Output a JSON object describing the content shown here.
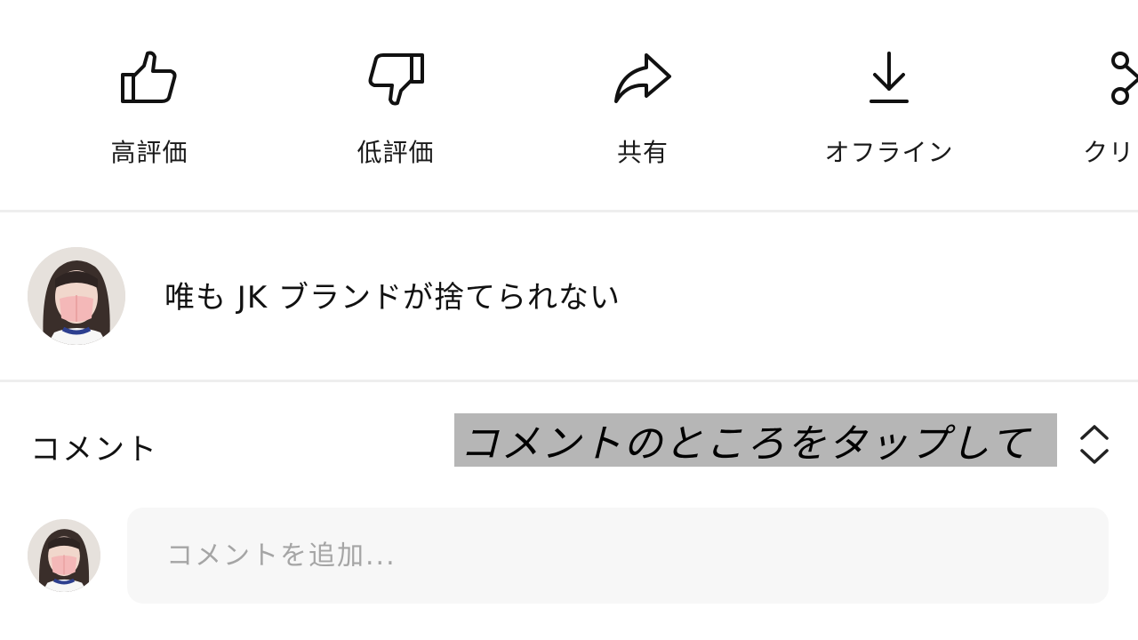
{
  "actions": [
    {
      "id": "like",
      "label": "高評価",
      "icon": "thumbs-up-icon"
    },
    {
      "id": "dislike",
      "label": "低評価",
      "icon": "thumbs-down-icon"
    },
    {
      "id": "share",
      "label": "共有",
      "icon": "share-arrow-icon"
    },
    {
      "id": "download",
      "label": "オフライン",
      "icon": "download-icon"
    },
    {
      "id": "clip",
      "label": "クリ",
      "icon": "scissors-icon"
    }
  ],
  "channel": {
    "title": "唯も JK ブランドが捨てられない",
    "avatar_icon": "channel-avatar"
  },
  "comments": {
    "label": "コメント",
    "overlay_caption": "コメントのところをタップして",
    "sort_icon": "chevron-up-down-icon"
  },
  "add_comment": {
    "placeholder": "コメントを追加..."
  },
  "colors": {
    "background": "#ffffff",
    "divider": "#eeeeee",
    "caption_highlight": "#b6b6b6",
    "input_background": "#f7f7f7",
    "placeholder_text": "#a5a5a5"
  }
}
